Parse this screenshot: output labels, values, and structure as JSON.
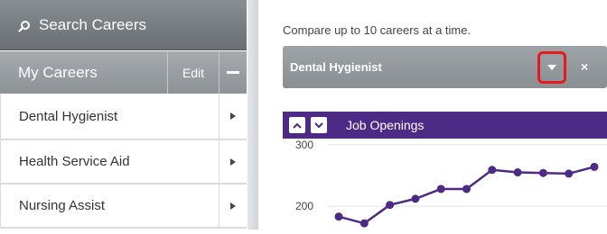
{
  "sidebar": {
    "search_label": "Search Careers",
    "my_careers_label": "My Careers",
    "edit_label": "Edit",
    "items": [
      {
        "label": "Dental Hygienist"
      },
      {
        "label": "Health Service Aid"
      },
      {
        "label": "Nursing Assist"
      }
    ]
  },
  "main": {
    "compare_text": "Compare up to 10 careers at a time.",
    "selected_career": "Dental Hygienist",
    "remove_symbol": "×",
    "highlight_color": "#e5191e"
  },
  "chart_data": {
    "type": "line",
    "title": "Job Openings",
    "y_tick_labels": [
      "300",
      "200"
    ],
    "ylim": [
      162,
      310
    ],
    "series": [
      {
        "values": [
          183,
          172,
          202,
          212,
          228,
          228,
          259,
          255,
          254,
          253,
          264
        ]
      }
    ],
    "color": "#4c2a85",
    "grid": true
  }
}
